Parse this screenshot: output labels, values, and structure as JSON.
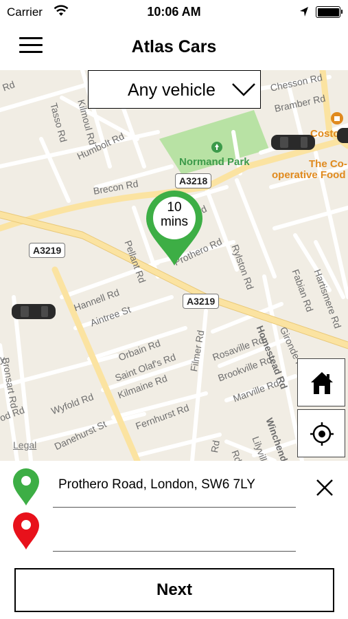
{
  "status_bar": {
    "carrier": "Carrier",
    "time": "10:06 AM"
  },
  "nav": {
    "title": "Atlas Cars",
    "menu_icon": "hamburger-menu-icon"
  },
  "vehicle_select": {
    "value": "Any vehicle"
  },
  "map": {
    "streets": [
      "Rd",
      "Tasso Rd",
      "Kilmoul Rd",
      "Chesson Rd",
      "Bramber Rd",
      "Humbolt Rd",
      "Brecon Rd",
      "Pellant Rd",
      "Prothero Rd",
      "Rylston Rd",
      "Hannell Rd",
      "Aintree St",
      "Bronsart Rd",
      "Orbain Rd",
      "Saint Olaf's Rd",
      "Kilmaine Rd",
      "Wyfold Rd",
      "Danehurst St",
      "Fernhurst Rd",
      "Filmer Rd",
      "Rosaville Rd",
      "Brookville Rd",
      "Marville Rd",
      "Homestead Rd",
      "Gironde Rd",
      "Fabian Rd",
      "Hartismere Rd",
      "Winchendon",
      "Lilyville",
      "Rd",
      "Rd",
      "Rd",
      "od Rd",
      "y"
    ],
    "park": "Normand Park",
    "poi": [
      "Costc",
      "The Co-",
      "operative Food"
    ],
    "road_badges": [
      "A3218",
      "A3219",
      "A3219"
    ],
    "legal": "Legal",
    "eta": {
      "value": "10",
      "unit": "mins"
    }
  },
  "controls": {
    "home_icon": "home-icon",
    "locate_icon": "locate-me-icon"
  },
  "form": {
    "pickup_value": "Prothero Road, London, SW6 7LY",
    "dropoff_value": "",
    "next_label": "Next"
  },
  "colors": {
    "pickup_pin": "#3dae45",
    "dropoff_pin": "#e8111b",
    "park": "#b8e2a4",
    "map_bg": "#f1ede4",
    "major_road": "#fbe3a1"
  }
}
